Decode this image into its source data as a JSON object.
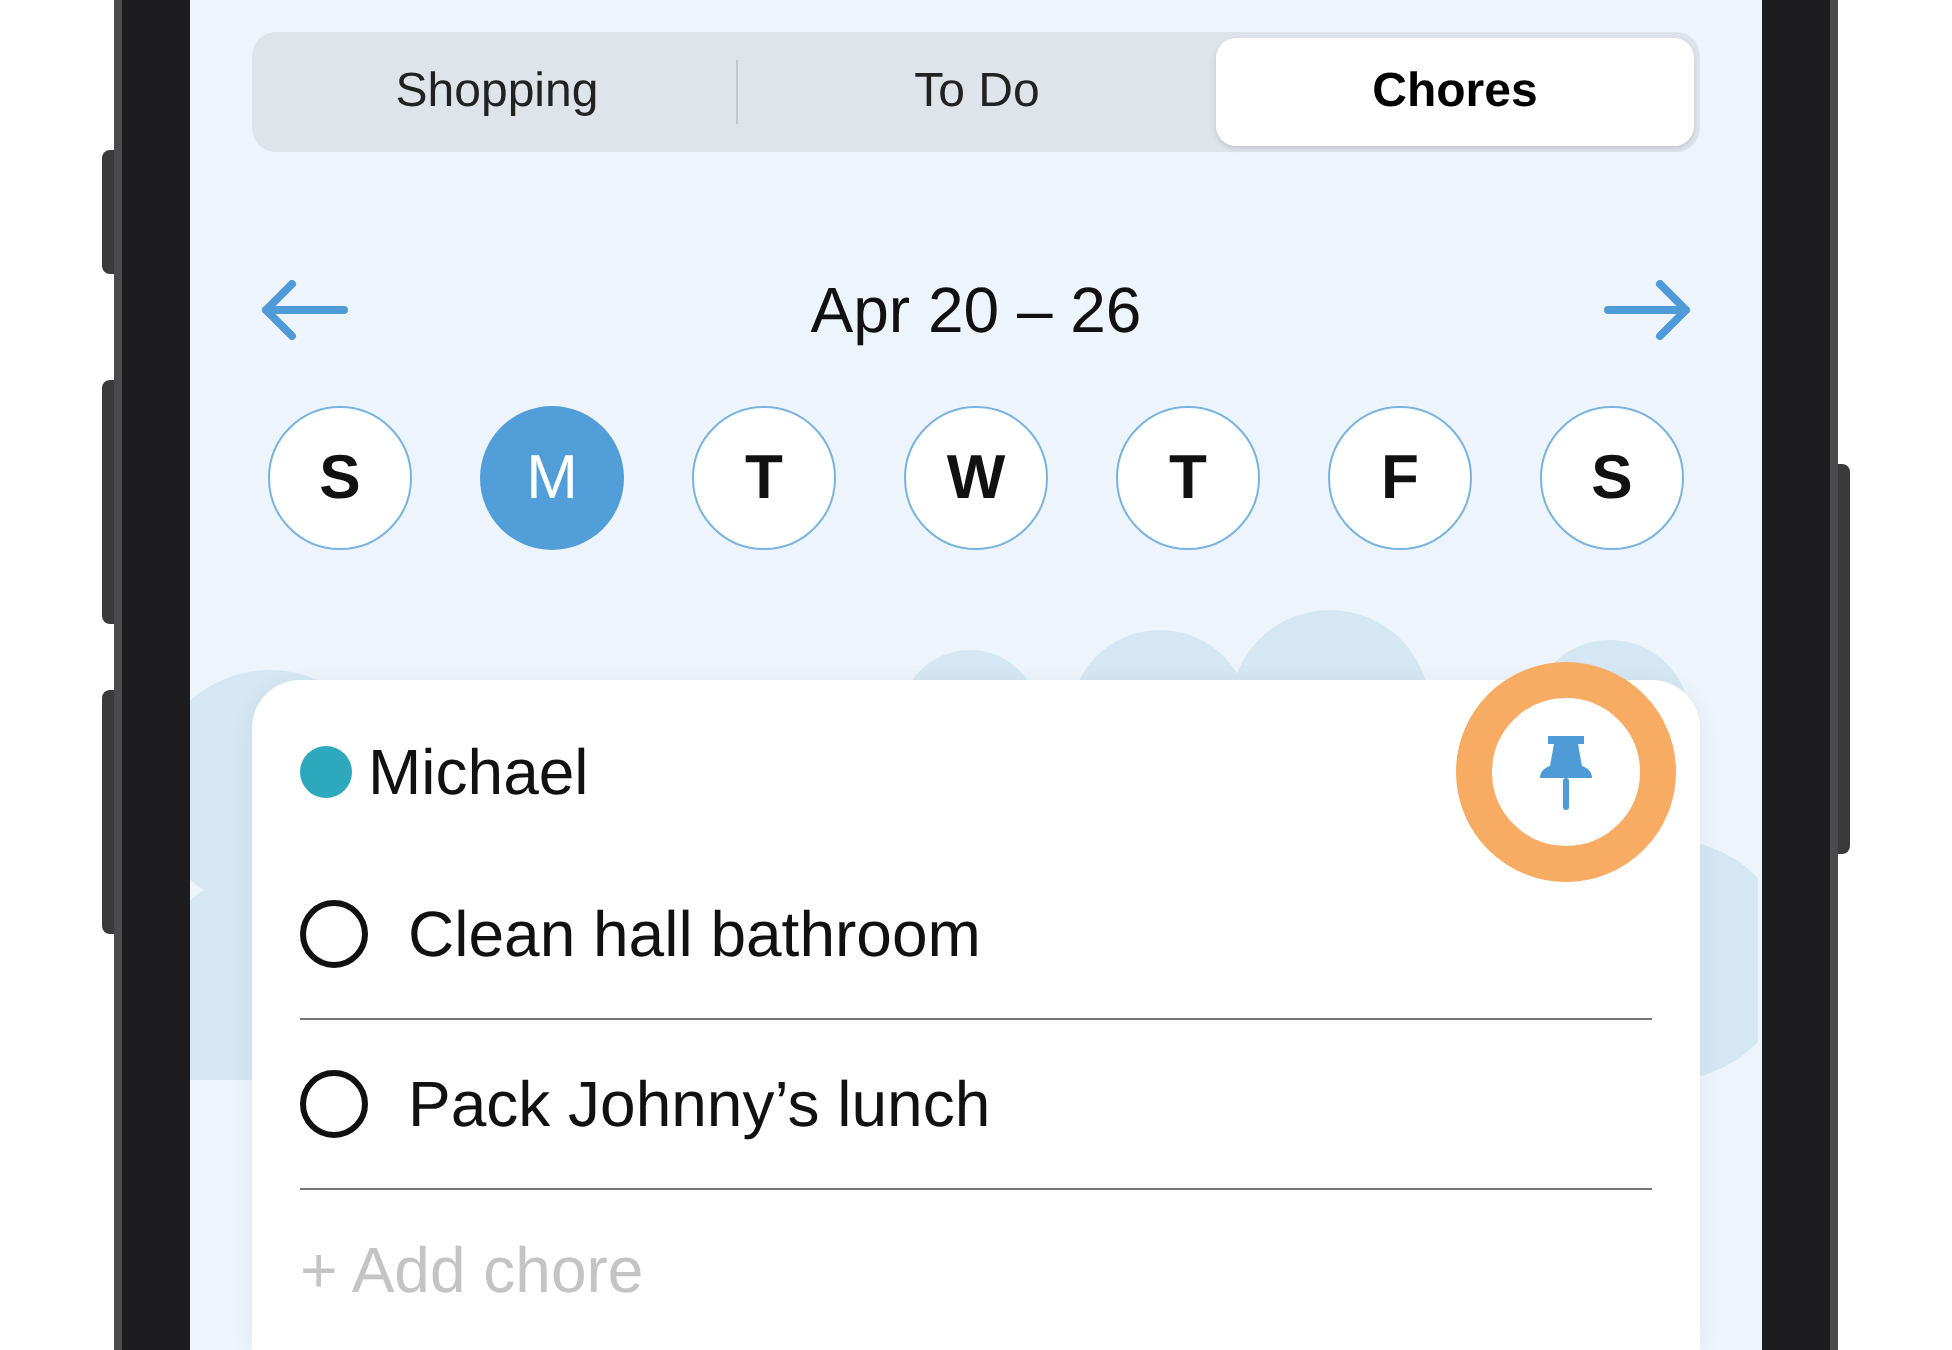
{
  "tabs": [
    {
      "label": "Shopping",
      "selected": false
    },
    {
      "label": "To Do",
      "selected": false
    },
    {
      "label": "Chores",
      "selected": true
    }
  ],
  "week": {
    "label": "Apr 20 – 26"
  },
  "days": [
    {
      "label": "S",
      "selected": false
    },
    {
      "label": "M",
      "selected": true
    },
    {
      "label": "T",
      "selected": false
    },
    {
      "label": "W",
      "selected": false
    },
    {
      "label": "T",
      "selected": false
    },
    {
      "label": "F",
      "selected": false
    },
    {
      "label": "S",
      "selected": false
    }
  ],
  "card": {
    "member": "Michael",
    "color": "#2ea8bd",
    "pin_button": {
      "highlighted": true
    },
    "chores": [
      {
        "label": "Clean hall bathroom",
        "checked": false
      },
      {
        "label": "Pack Johnny’s lunch",
        "checked": false
      }
    ],
    "add_placeholder": "+ Add chore"
  }
}
